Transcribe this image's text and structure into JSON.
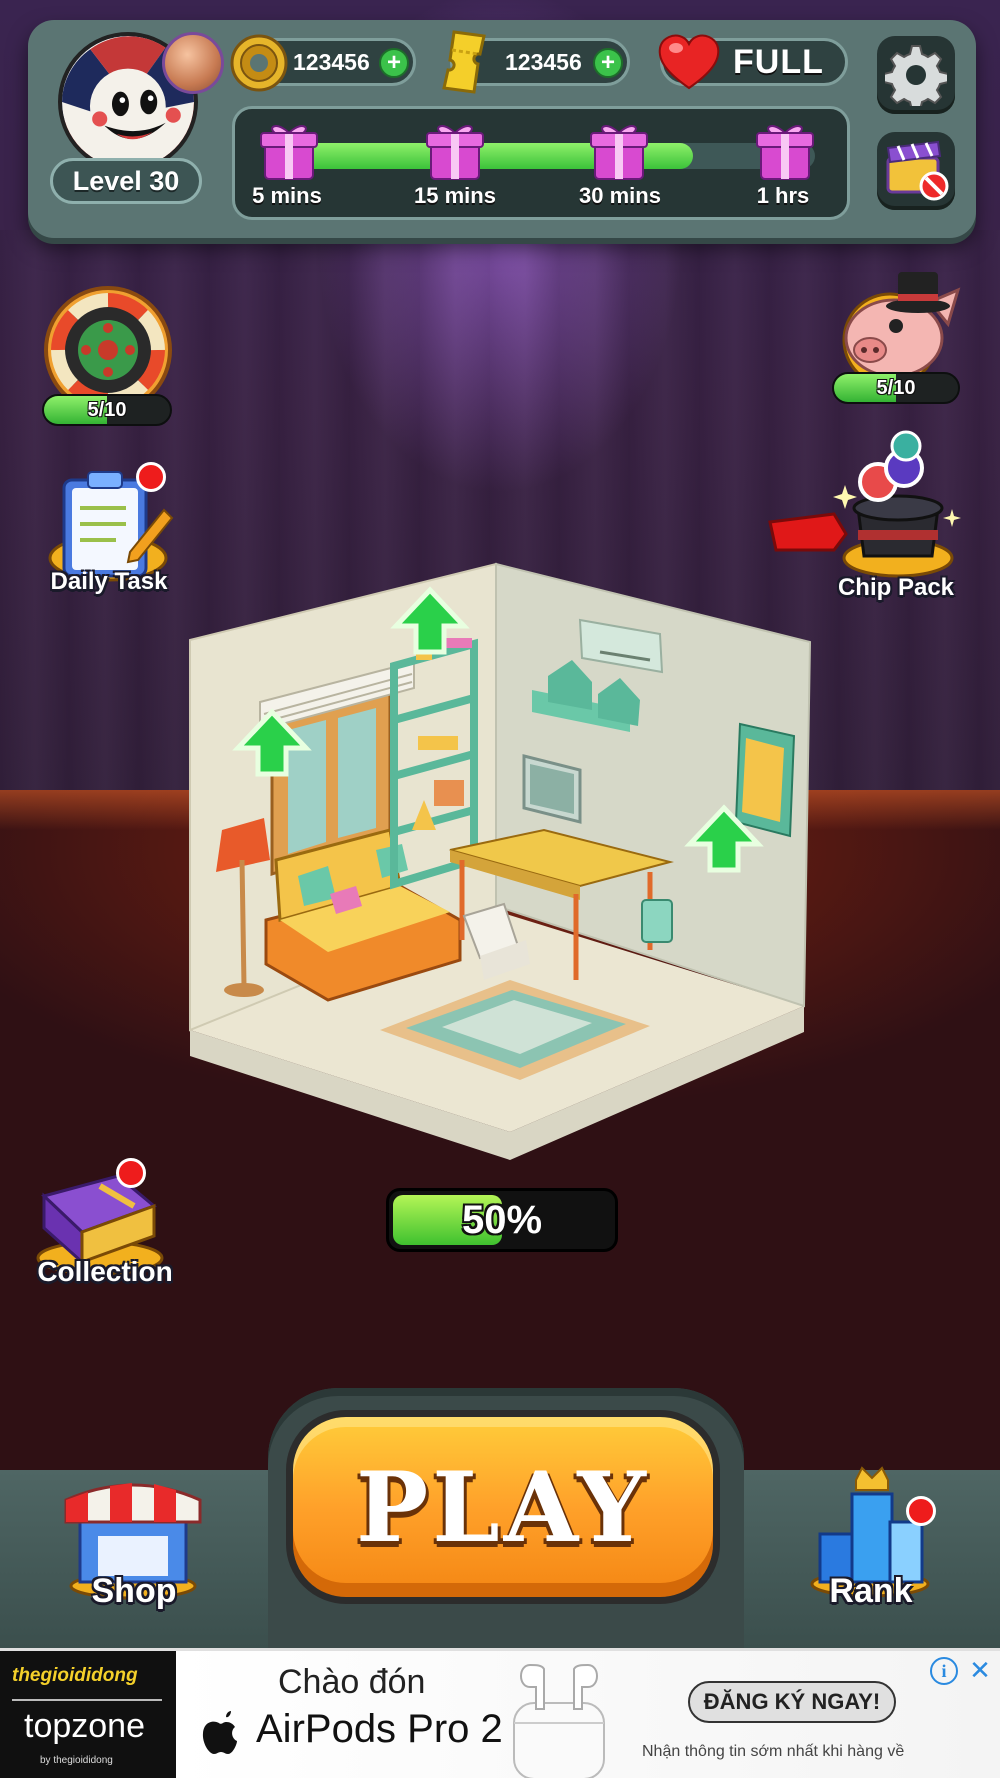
{
  "player": {
    "level_label": "Level 30"
  },
  "resources": {
    "coins": "123456",
    "tickets": "123456",
    "lives": "FULL"
  },
  "gift_track": {
    "progress": 0.77,
    "milestones": [
      {
        "label": "5 mins"
      },
      {
        "label": "15 mins"
      },
      {
        "label": "30 mins"
      },
      {
        "label": "1 hrs"
      }
    ]
  },
  "side_buttons": {
    "wheel": {
      "progress_text": "5/10",
      "progress": 0.5
    },
    "piggy": {
      "progress_text": "5/10",
      "progress": 0.5
    },
    "daily_task": {
      "label": "Daily Task",
      "has_notification": true
    },
    "chip_pack": {
      "label": "Chip Pack"
    },
    "collection": {
      "label": "Collection",
      "has_notification": true
    }
  },
  "room": {
    "progress_text": "50%",
    "progress": 0.5
  },
  "bottom_nav": {
    "play_label": "PLAY",
    "shop_label": "Shop",
    "rank_label": "Rank",
    "rank_has_notification": true
  },
  "ad": {
    "brand": "thegioididong",
    "brand_sub": "topzone",
    "brand_sub_by": "by thegioididong",
    "headline_top": "Chào đón",
    "headline_product": "AirPods Pro 2",
    "cta": "ĐĂNG KÝ NGAY!",
    "subtext": "Nhận thông tin sớm nhất khi hàng về"
  },
  "colors": {
    "panel": "#5b7573",
    "progress_green": "#3bc23a",
    "play_orange": "#ffa12a",
    "notification_red": "#ee1c1c"
  },
  "icons": [
    "avatar-clown",
    "bronze-medal-icon",
    "coin-icon",
    "ticket-icon",
    "heart-icon",
    "gear-icon",
    "video-ad-icon",
    "gift-icon",
    "roulette-wheel-icon",
    "piggy-bank-icon",
    "clipboard-icon",
    "chip-pack-icon",
    "collection-book-icon",
    "shop-stall-icon",
    "rank-trophy-icon",
    "upgrade-arrow-icon",
    "ad-info-icon",
    "ad-close-icon",
    "apple-logo-icon"
  ]
}
